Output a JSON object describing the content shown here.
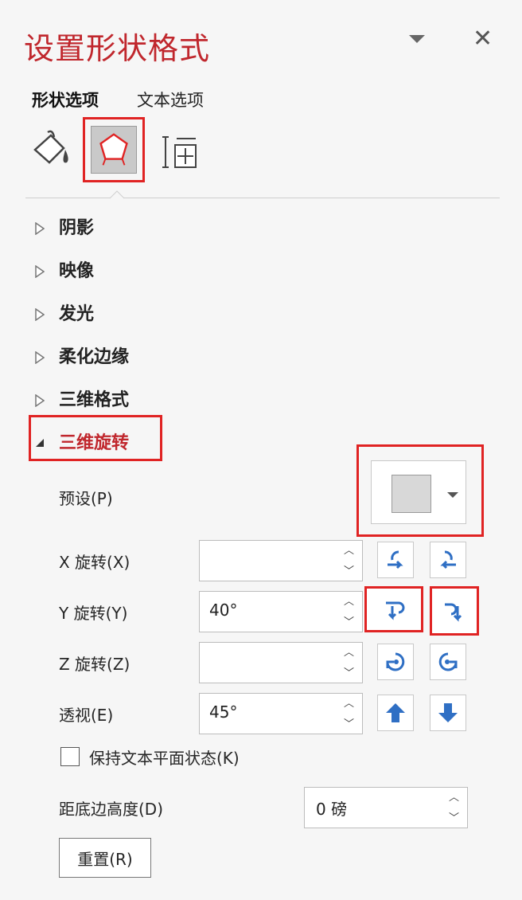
{
  "pane": {
    "title": "设置形状格式",
    "tabs": [
      {
        "label": "形状选项"
      },
      {
        "label": "文本选项"
      }
    ],
    "icons": [
      "fill-line-icon",
      "effects-icon",
      "size-properties-icon"
    ]
  },
  "sections": [
    {
      "label": "阴影",
      "expanded": false
    },
    {
      "label": "映像",
      "expanded": false
    },
    {
      "label": "发光",
      "expanded": false
    },
    {
      "label": "柔化边缘",
      "expanded": false
    },
    {
      "label": "三维格式",
      "expanded": false
    },
    {
      "label": "三维旋转",
      "expanded": true
    }
  ],
  "rotation3d": {
    "preset_label": "预设(P)",
    "x_label": "X 旋转(X)",
    "x_value": "",
    "y_label": "Y 旋转(Y)",
    "y_value": "40°",
    "z_label": "Z 旋转(Z)",
    "z_value": "",
    "perspective_label": "透视(E)",
    "perspective_value": "45°",
    "keep_text_flat_label": "保持文本平面状态(K)",
    "keep_text_flat_checked": false,
    "distance_label": "距底边高度(D)",
    "distance_value": "0 磅",
    "reset_label": "重置(R)"
  },
  "colors": {
    "accent": "#c0272d",
    "highlight": "#e02323",
    "icon_blue": "#2f6fc4"
  }
}
